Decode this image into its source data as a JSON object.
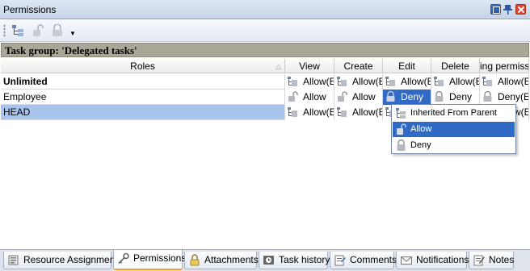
{
  "window": {
    "title": "Permissions"
  },
  "group": {
    "label": "Task group: 'Delegated tasks'"
  },
  "columns": {
    "roles": "Roles",
    "view": "View",
    "create": "Create",
    "edit": "Edit",
    "delete": "Delete",
    "changing": "ing permiss"
  },
  "rows": [
    {
      "role": "Unlimited",
      "bold": true,
      "perms": [
        "Allow(E",
        "Allow(E",
        "Allow(E",
        "Allow(E",
        "Allow(E"
      ]
    },
    {
      "role": "Employee",
      "bold": false,
      "perms": [
        "Allow",
        "Allow",
        "Deny",
        "Deny",
        "Deny(E"
      ]
    },
    {
      "role": "HEAD",
      "bold": false,
      "perms": [
        "Allow(E",
        "Allow(E",
        "",
        "",
        "Allow(E"
      ]
    }
  ],
  "menu": {
    "items": [
      "Inherited From Parent",
      "Allow",
      "Deny"
    ]
  },
  "tabs": [
    "Resource Assignment",
    "Permissions",
    "Attachments",
    "Task history",
    "Comments",
    "Notifications",
    "Notes"
  ],
  "colors": {
    "accent": "#316ac5",
    "selected_row": "#a9c4ec",
    "group_bar": "#aaa799",
    "active_tab_underline": "#f3a13a"
  }
}
